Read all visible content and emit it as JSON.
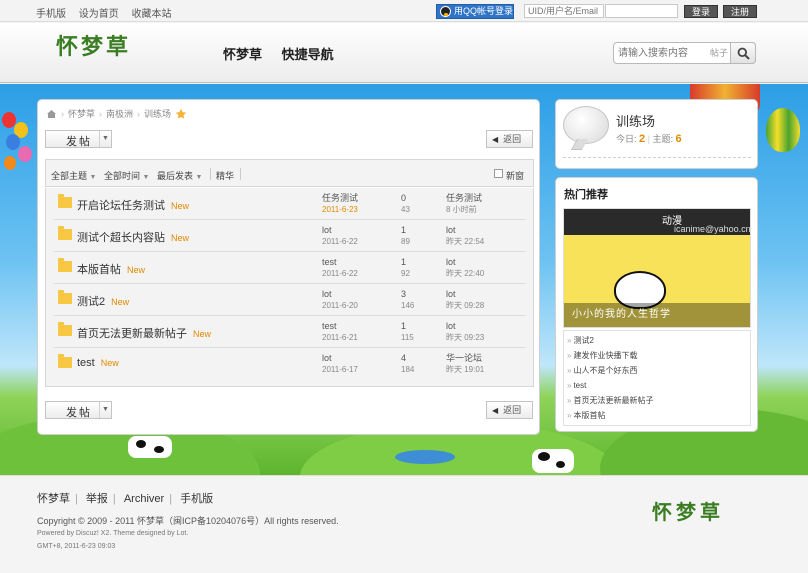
{
  "topbar": {
    "links": [
      "手机版",
      "设为首页",
      "收藏本站"
    ],
    "qq_login": "用QQ帐号登录",
    "uid_placeholder": "UID/用户名/Email",
    "login_label": "登录",
    "register_label": "注册"
  },
  "header": {
    "logo": "怀梦草",
    "nav": [
      "怀梦草",
      "快捷导航"
    ],
    "search_placeholder": "请输入搜索内容",
    "search_scope": "帖子"
  },
  "breadcrumb": [
    "怀梦草",
    "南极洲",
    "训练场"
  ],
  "toolbar": {
    "post_label": "发帖",
    "back_label": "返回"
  },
  "filters": [
    "全部主题",
    "全部时间",
    "最后发表",
    "精华"
  ],
  "new_window_label": "新窗",
  "threads": [
    {
      "title": "开启论坛任务测试",
      "new": "New",
      "author": "任务测试",
      "date": "2011-6-23",
      "replies": "0",
      "views": "43",
      "last_user": "任务测试",
      "last_time": "8 小时前"
    },
    {
      "title": "测试个超长内容贴",
      "new": "New",
      "author": "lot",
      "date": "2011-6-22",
      "replies": "1",
      "views": "89",
      "last_user": "lot",
      "last_time": "昨天 22:54"
    },
    {
      "title": "本版首帖",
      "new": "New",
      "author": "test",
      "date": "2011-6-22",
      "replies": "1",
      "views": "92",
      "last_user": "lot",
      "last_time": "昨天 22:40"
    },
    {
      "title": "测试2",
      "new": "New",
      "author": "lot",
      "date": "2011-6-20",
      "replies": "3",
      "views": "146",
      "last_user": "lot",
      "last_time": "昨天 09:28"
    },
    {
      "title": "首页无法更新最新帖子",
      "new": "New",
      "author": "test",
      "date": "2011-6-21",
      "replies": "1",
      "views": "115",
      "last_user": "lot",
      "last_time": "昨天 09:23"
    },
    {
      "title": "test",
      "new": "New",
      "author": "lot",
      "date": "2011-6-17",
      "replies": "4",
      "views": "184",
      "last_user": "华一论坛",
      "last_time": "昨天 19:01"
    }
  ],
  "forum": {
    "name": "训练场",
    "today_label": "今日:",
    "today_value": "2",
    "topics_label": "主题:",
    "topics_value": "6"
  },
  "hot": {
    "title": "热门推荐",
    "promo_brand": "动漫",
    "promo_email": "icanime@yahoo.cn",
    "promo_caption": "小小的我的人生哲学",
    "list": [
      "测试2",
      "建发作业快播下载",
      "山人不是个好东西",
      "test",
      "首页无法更新最新帖子",
      "本版首帖"
    ]
  },
  "footer": {
    "links": [
      "怀梦草",
      "举报",
      "Archiver",
      "手机版"
    ],
    "copyright": "Copyright © 2009 - 2011 怀梦草（闽ICP备10204076号）All rights reserved.",
    "powered": "Powered by Discuz! X2. Theme designed by Lot.",
    "gmt": "GMT+8, 2011-6-23 09:03",
    "logo": "怀梦草"
  },
  "colors": {
    "accent_orange": "#e08a00",
    "brand_green": "#3a7d22",
    "sky_blue": "#2c9ee6"
  }
}
